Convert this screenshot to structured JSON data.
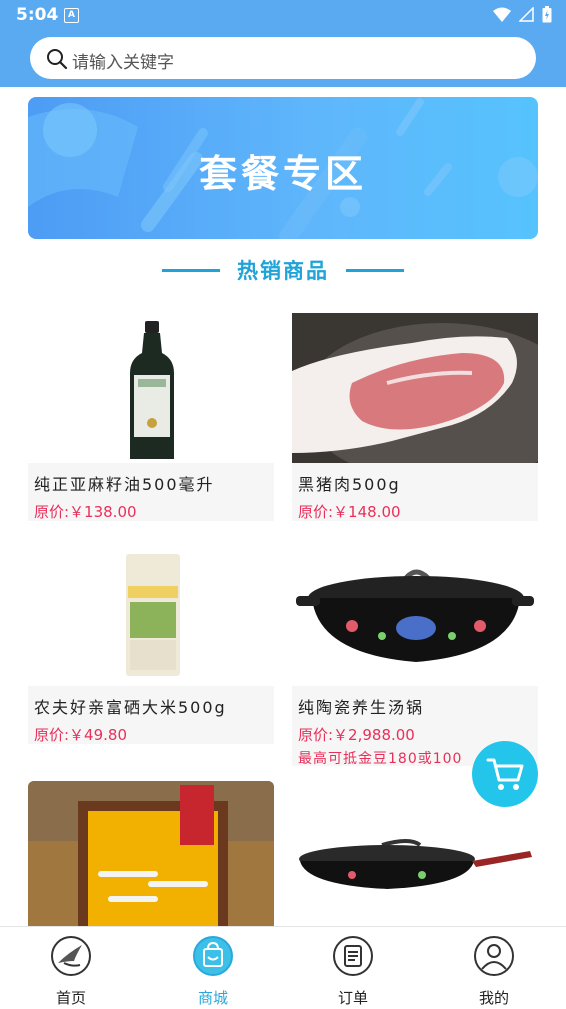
{
  "status_bar": {
    "time": "5:04",
    "notification_letter": "A"
  },
  "search": {
    "placeholder": "请输入关键字"
  },
  "banner": {
    "title": "套餐专区"
  },
  "section": {
    "title": "热销商品"
  },
  "products": [
    {
      "name": "纯正亚麻籽油500毫升",
      "price": "原价:￥138.00"
    },
    {
      "name": "黑猪肉500g",
      "price": "原价:￥148.00"
    },
    {
      "name": "农夫好亲富硒大米500g",
      "price": "原价:￥49.80"
    },
    {
      "name": "纯陶瓷养生汤锅",
      "price": "原价:￥2,988.00",
      "extra": "最高可抵金豆180或100"
    }
  ],
  "tabs": [
    {
      "label": "首页",
      "icon": "bird-icon"
    },
    {
      "label": "商城",
      "icon": "shopping-bag-icon",
      "active": true
    },
    {
      "label": "订单",
      "icon": "order-list-icon"
    },
    {
      "label": "我的",
      "icon": "user-icon"
    }
  ],
  "colors": {
    "header": "#5aaaf2",
    "accent": "#1fa3d8",
    "price": "#e8305a",
    "cart": "#23c6ea"
  }
}
